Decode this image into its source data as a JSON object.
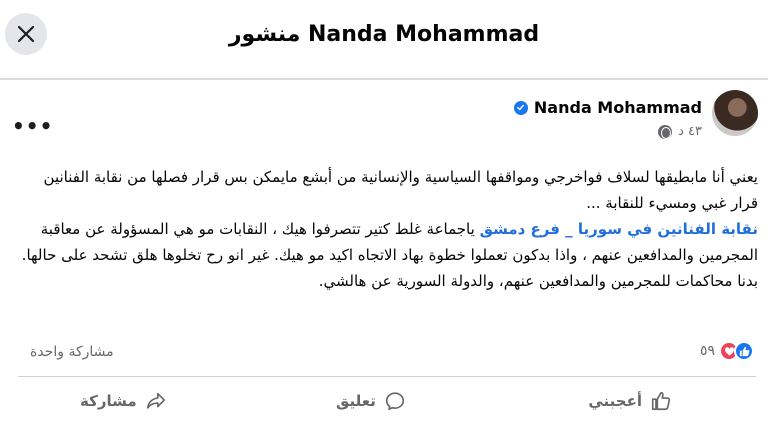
{
  "header": {
    "title": "Nanda Mohammad منشور"
  },
  "post": {
    "author": "Nanda Mohammad",
    "timestamp": "٤٣ د",
    "body_line1": "يعني أنا مابطيقها لسلاف فواخرجي ومواقفها السياسية والإنسانية من أبشع مايمكن بس قرار فصلها من نقابة الفنانين قرار غبي ومسيء للنقابة ...",
    "mention": "نقابة الفنانين في سوريا _ فرع دمشق",
    "body_line2": " ياجماعة غلط كتير تتصرفوا هيك ، النقابات مو هي المسؤولة عن معاقبة المجرمين والمدافعين عنهم ، واذا بدكون تعملوا خطوة بهاد الاتجاه اكيد مو هيك.  غير انو رح تخلوها هلق تشحد على حالها.",
    "body_line3": "بدنا محاكمات للمجرمين والمدافعين عنهم، والدولة السورية عن هالشي."
  },
  "stats": {
    "reaction_count": "٥٩",
    "shares": "مشاركة واحدة"
  },
  "actions": {
    "like": "أعجبني",
    "comment": "تعليق",
    "share": "مشاركة"
  },
  "colors": {
    "accent": "#1877f2",
    "mention": "#216fdb",
    "love": "#f33e58",
    "muted": "#65676b"
  }
}
